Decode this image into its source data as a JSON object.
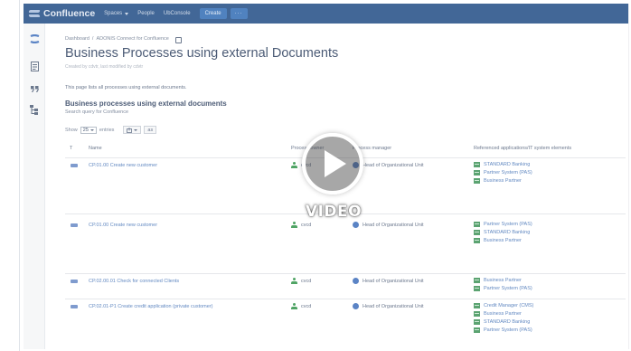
{
  "app": {
    "logo_text": "Confluence",
    "nav": [
      "Spaces",
      "People",
      "UbConsole"
    ],
    "create_label": "Create",
    "more_label": "···"
  },
  "sidebar": {
    "icons": [
      "confluence-mark-icon",
      "page-icon",
      "quote-icon",
      "tree-icon"
    ]
  },
  "breadcrumb": [
    "Dashboard",
    "/",
    "ADONIS Connect for Confluence"
  ],
  "page": {
    "title": "Business Processes using external Documents",
    "meta": "Created by cdvtr, last modified by cdvtr",
    "intro": "This page lists all processes using external documents.",
    "section_title": "Business processes using external documents",
    "section_sub": "Search query for Confluence"
  },
  "controls": {
    "show_label": "Show",
    "page_size": "25",
    "entries_label": "entries",
    "export_icon": "export-icon",
    "filter_label": "as"
  },
  "table": {
    "headers": {
      "t": "T",
      "name": "Name",
      "owner": "Process owner",
      "mgr": "Process manager",
      "ref": "Referenced applications/IT system elements"
    },
    "rows": [
      {
        "name": "CP.01.00 Create new customer",
        "owner": "cvcd",
        "mgr": "Head of Organizational Unit",
        "refs": [
          "STANDARD Banking",
          "Partner System (PAS)",
          "Business Partner"
        ]
      },
      {
        "name": "CP.01.00 Create new customer",
        "owner": "cvcd",
        "mgr": "Head of Organizational Unit",
        "refs": [
          "Partner System (PAS)",
          "STANDARD Banking",
          "Business Partner"
        ]
      },
      {
        "name": "CP.02.00.01 Check for connected Clients",
        "owner": "cvcd",
        "mgr": "Head of Organizational Unit",
        "refs": [
          "Business Partner",
          "Partner System (PAS)"
        ]
      },
      {
        "name": "CP.02.01-P1 Create credit application (private customer)",
        "owner": "cvcd",
        "mgr": "Head of Organizational Unit",
        "refs": [
          "Credit Manager (CMS)",
          "Business Partner",
          "STANDARD Banking",
          "Partner System (PAS)"
        ]
      }
    ]
  },
  "overlay": {
    "video_label": "VIDEO"
  }
}
